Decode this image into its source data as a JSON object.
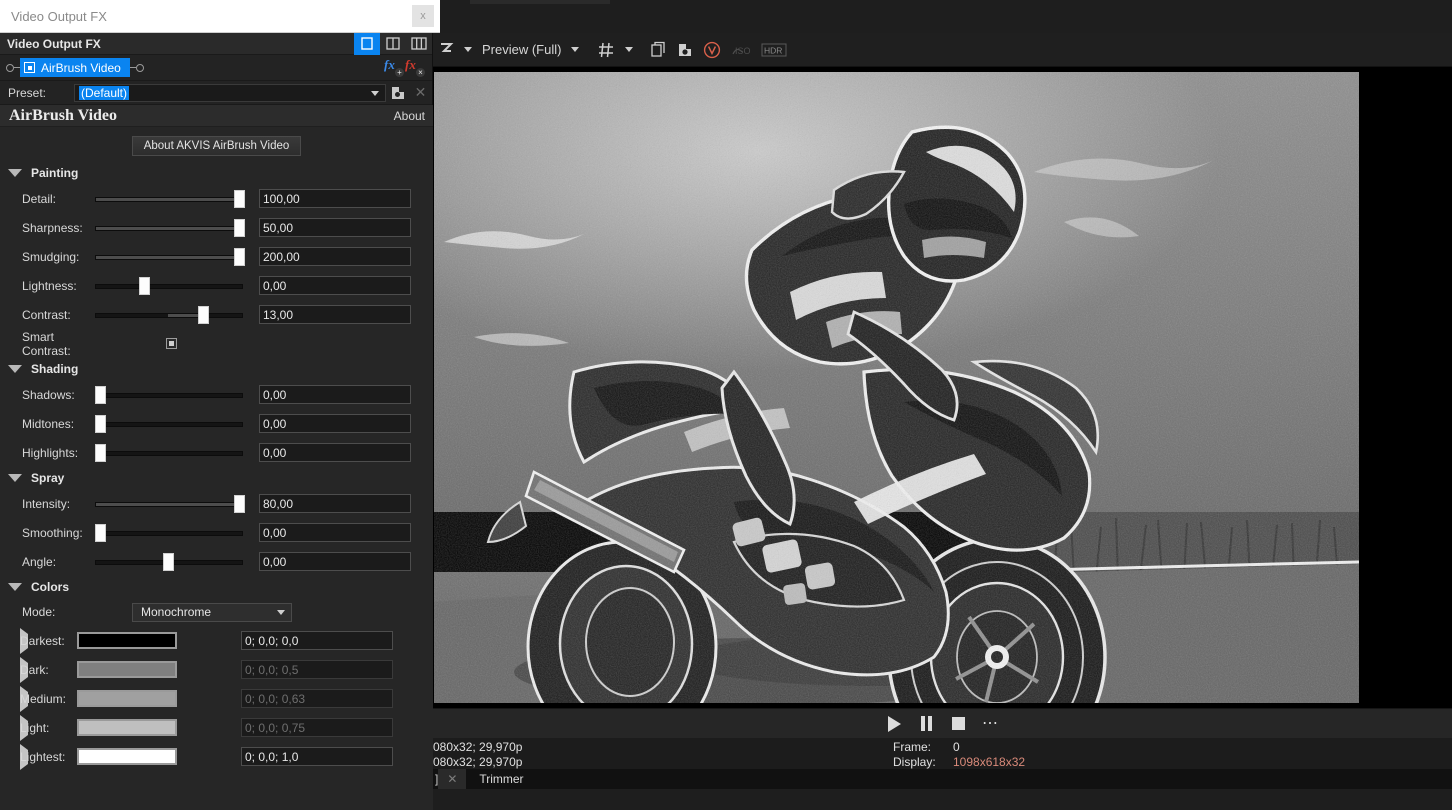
{
  "window": {
    "title": "Video Output FX",
    "close_label": "x"
  },
  "panel": {
    "header_title": "Video Output FX",
    "view_modes": [
      {
        "name": "single-view",
        "glyph": "▯",
        "active": true
      },
      {
        "name": "split-view",
        "glyph": "◫",
        "active": false
      },
      {
        "name": "triple-view",
        "glyph": "⦀",
        "active": false
      }
    ],
    "chain": {
      "node_label": "AirBrush Video",
      "add_fx_label": "fx",
      "remove_fx_label": "fx"
    },
    "preset": {
      "label": "Preset:",
      "value": "(Default)",
      "save_title": "save-preset",
      "delete_title": "delete-preset"
    }
  },
  "plugin": {
    "title": "AirBrush Video",
    "about_link": "About",
    "about_button": "About AKVIS AirBrush Video",
    "groups": [
      {
        "name": "Painting",
        "params": [
          {
            "label": "Detail:",
            "value": "100,00",
            "knob": 96,
            "fill": 96,
            "type": "slider"
          },
          {
            "label": "Sharpness:",
            "value": "50,00",
            "knob": 96,
            "fill": 96,
            "type": "slider"
          },
          {
            "label": "Smudging:",
            "value": "200,00",
            "knob": 96,
            "fill": 96,
            "type": "slider"
          },
          {
            "label": "Lightness:",
            "value": "0,00",
            "knob": 31,
            "fill": 0,
            "type": "slider"
          },
          {
            "label": "Contrast:",
            "value": "13,00",
            "knob": 72,
            "fill": 0,
            "fillfrom": 50,
            "type": "slider"
          },
          {
            "label": "Smart Contrast:",
            "value": "",
            "checked": true,
            "type": "checkbox"
          }
        ]
      },
      {
        "name": "Shading",
        "params": [
          {
            "label": "Shadows:",
            "value": "0,00",
            "knob": 0,
            "fill": 0,
            "type": "slider"
          },
          {
            "label": "Midtones:",
            "value": "0,00",
            "knob": 0,
            "fill": 0,
            "type": "slider"
          },
          {
            "label": "Highlights:",
            "value": "0,00",
            "knob": 0,
            "fill": 0,
            "type": "slider"
          }
        ]
      },
      {
        "name": "Spray",
        "params": [
          {
            "label": "Intensity:",
            "value": "80,00",
            "knob": 96,
            "fill": 96,
            "type": "slider"
          },
          {
            "label": "Smoothing:",
            "value": "0,00",
            "knob": 0,
            "fill": 0,
            "type": "slider"
          },
          {
            "label": "Angle:",
            "value": "0,00",
            "knob": 47,
            "fill": 0,
            "type": "slider"
          }
        ]
      }
    ],
    "colors": {
      "group_name": "Colors",
      "mode_label": "Mode:",
      "mode_value": "Monochrome",
      "swatches": [
        {
          "label": "Darkest:",
          "value": "0; 0,0; 0,0",
          "hex": "#000000",
          "dim": false
        },
        {
          "label": "Dark:",
          "value": "0; 0,0; 0,5",
          "hex": "#808080",
          "dim": true
        },
        {
          "label": "Medium:",
          "value": "0; 0,0; 0,63",
          "hex": "#a0a0a0",
          "dim": true
        },
        {
          "label": "Light:",
          "value": "0; 0,0; 0,75",
          "hex": "#bfbfbf",
          "dim": true
        },
        {
          "label": "Lightest:",
          "value": "0; 0,0; 1,0",
          "hex": "#ffffff",
          "dim": false
        }
      ]
    }
  },
  "toolbar": {
    "tool_icon": "edit-tool-icon",
    "preview_label": "Preview (Full)",
    "grid_icon": "grid-icon",
    "copy_icon": "copy-snapshot-icon",
    "save_icon": "save-snapshot-icon",
    "v_icon": "vegas-v-icon",
    "iso_icon": "iso-icon",
    "hdr_icon": "HDR"
  },
  "transport": {
    "play": "play-button",
    "pause": "pause-button",
    "stop": "stop-button",
    "more": "⋯"
  },
  "status": {
    "line1": "080x32; 29,970p",
    "line2": "080x32; 29,970p",
    "frame_label": "Frame:",
    "frame_value": "0",
    "display_label": "Display:",
    "display_value": "1098x618x32"
  },
  "tabs": {
    "bracket": "]",
    "close": "✕",
    "label": "Trimmer"
  },
  "colors": {
    "accent": "#0a84f0",
    "panel_bg": "#262626",
    "status_red": "#d98a7a"
  }
}
